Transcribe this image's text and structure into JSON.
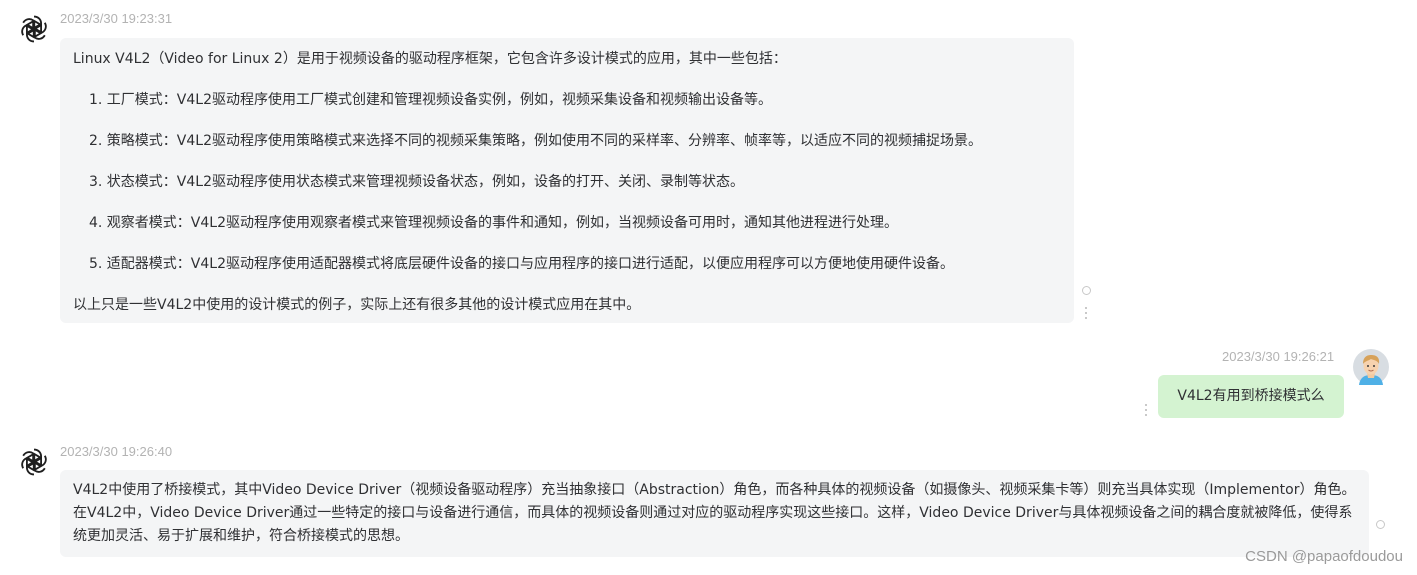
{
  "messages": [
    {
      "role": "assistant",
      "avatar_icon": "openai-logo-icon",
      "timestamp": "2023/3/30 19:23:31",
      "intro": "Linux V4L2（Video for Linux 2）是用于视频设备的驱动程序框架，它包含许多设计模式的应用，其中一些包括：",
      "items": [
        "1. 工厂模式：V4L2驱动程序使用工厂模式创建和管理视频设备实例，例如，视频采集设备和视频输出设备等。",
        "2. 策略模式：V4L2驱动程序使用策略模式来选择不同的视频采集策略，例如使用不同的采样率、分辨率、帧率等，以适应不同的视频捕捉场景。",
        "3. 状态模式：V4L2驱动程序使用状态模式来管理视频设备状态，例如，设备的打开、关闭、录制等状态。",
        "4. 观察者模式：V4L2驱动程序使用观察者模式来管理视频设备的事件和通知，例如，当视频设备可用时，通知其他进程进行处理。",
        "5. 适配器模式：V4L2驱动程序使用适配器模式将底层硬件设备的接口与应用程序的接口进行适配，以便应用程序可以方便地使用硬件设备。"
      ],
      "outro": "以上只是一些V4L2中使用的设计模式的例子，实际上还有很多其他的设计模式应用在其中。"
    },
    {
      "role": "user",
      "avatar_icon": "user-avatar-icon",
      "timestamp": "2023/3/30 19:26:21",
      "text": "V4L2有用到桥接模式么"
    },
    {
      "role": "assistant",
      "avatar_icon": "openai-logo-icon",
      "timestamp": "2023/3/30 19:26:40",
      "text": "V4L2中使用了桥接模式，其中Video Device Driver（视频设备驱动程序）充当抽象接口（Abstraction）角色，而各种具体的视频设备（如摄像头、视频采集卡等）则充当具体实现（Implementor）角色。在V4L2中，Video Device Driver通过一些特定的接口与设备进行通信，而具体的视频设备则通过对应的驱动程序实现这些接口。这样，Video Device Driver与具体视频设备之间的耦合度就被降低，使得系统更加灵活、易于扩展和维护，符合桥接模式的思想。"
    }
  ],
  "controls": {
    "refresh_icon": "refresh-circle-icon",
    "more_icon": "more-vertical-icon"
  },
  "watermark": "CSDN @papaofdoudou",
  "colors": {
    "assistant_bubble": "#f4f5f6",
    "user_bubble": "#d4f3d1",
    "timestamp": "#b3b3b3"
  }
}
